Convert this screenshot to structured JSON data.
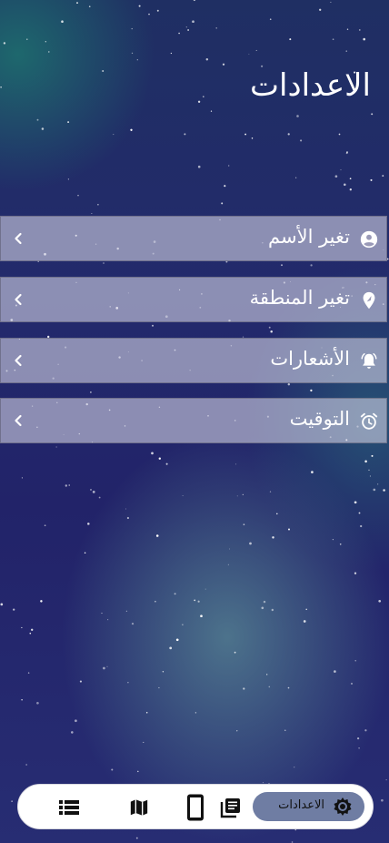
{
  "header": {
    "title": "الاعدادات"
  },
  "menu": {
    "items": [
      {
        "label": "تغير الأسم",
        "icon": "account-circle-icon"
      },
      {
        "label": "تغير المنطقة",
        "icon": "location-pin-icon"
      },
      {
        "label": "الأشعارات",
        "icon": "bell-ring-icon"
      },
      {
        "label": "التوقيت",
        "icon": "alarm-clock-icon"
      }
    ]
  },
  "nav": {
    "active_label": "الاعدادات",
    "items": [
      "settings-gear-icon",
      "library-books-icon",
      "smartphone-icon",
      "map-icon",
      "list-icon"
    ]
  },
  "colors": {
    "menu_row": "#c8c8dc",
    "nav_active": "#6f7da3",
    "background": "#232a6c"
  }
}
